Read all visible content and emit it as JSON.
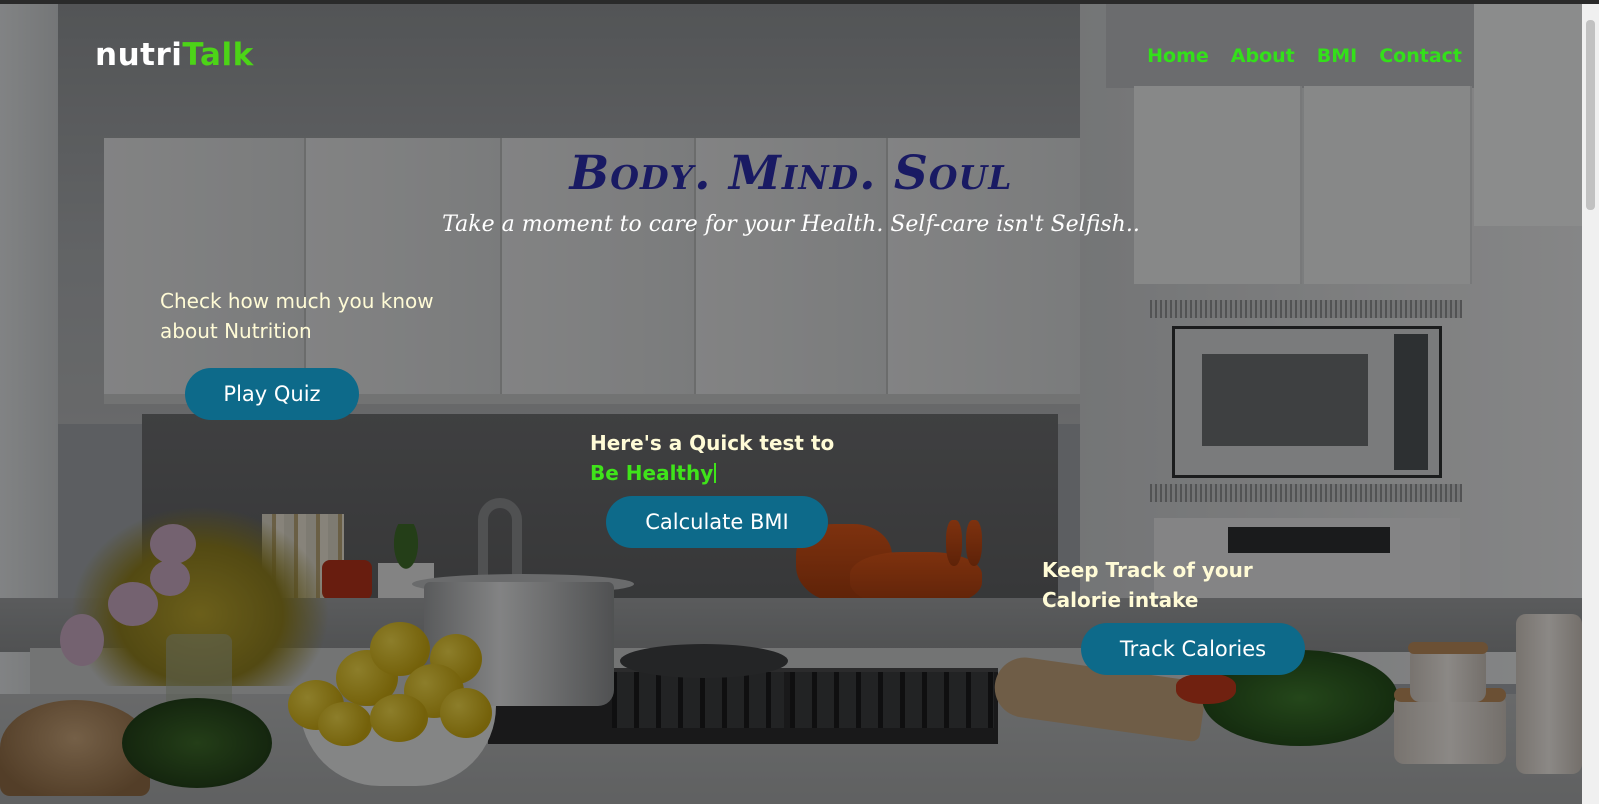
{
  "brand": {
    "logo_part1": "nutri",
    "logo_part2": "Talk"
  },
  "nav": {
    "items": [
      {
        "label": "Home"
      },
      {
        "label": "About"
      },
      {
        "label": "BMI"
      },
      {
        "label": "Contact"
      }
    ]
  },
  "hero": {
    "title": "Body. Mind. Soul",
    "subtitle": "Take a moment to care for your Health. Self-care isn't Selfish.."
  },
  "quiz": {
    "text": "Check how much you know about Nutrition",
    "button_label": "Play Quiz"
  },
  "bmi": {
    "text_line1": "Here's a Quick test to",
    "typed_text": "Be Healthy",
    "button_label": "Calculate BMI"
  },
  "calories": {
    "text": "Keep Track of your Calorie intake",
    "button_label": "Track Calories"
  },
  "colors": {
    "accent_green": "#33e01a",
    "button_teal": "#0d6a8a",
    "title_navy": "#191a63",
    "text_cream": "#fffbd6"
  }
}
